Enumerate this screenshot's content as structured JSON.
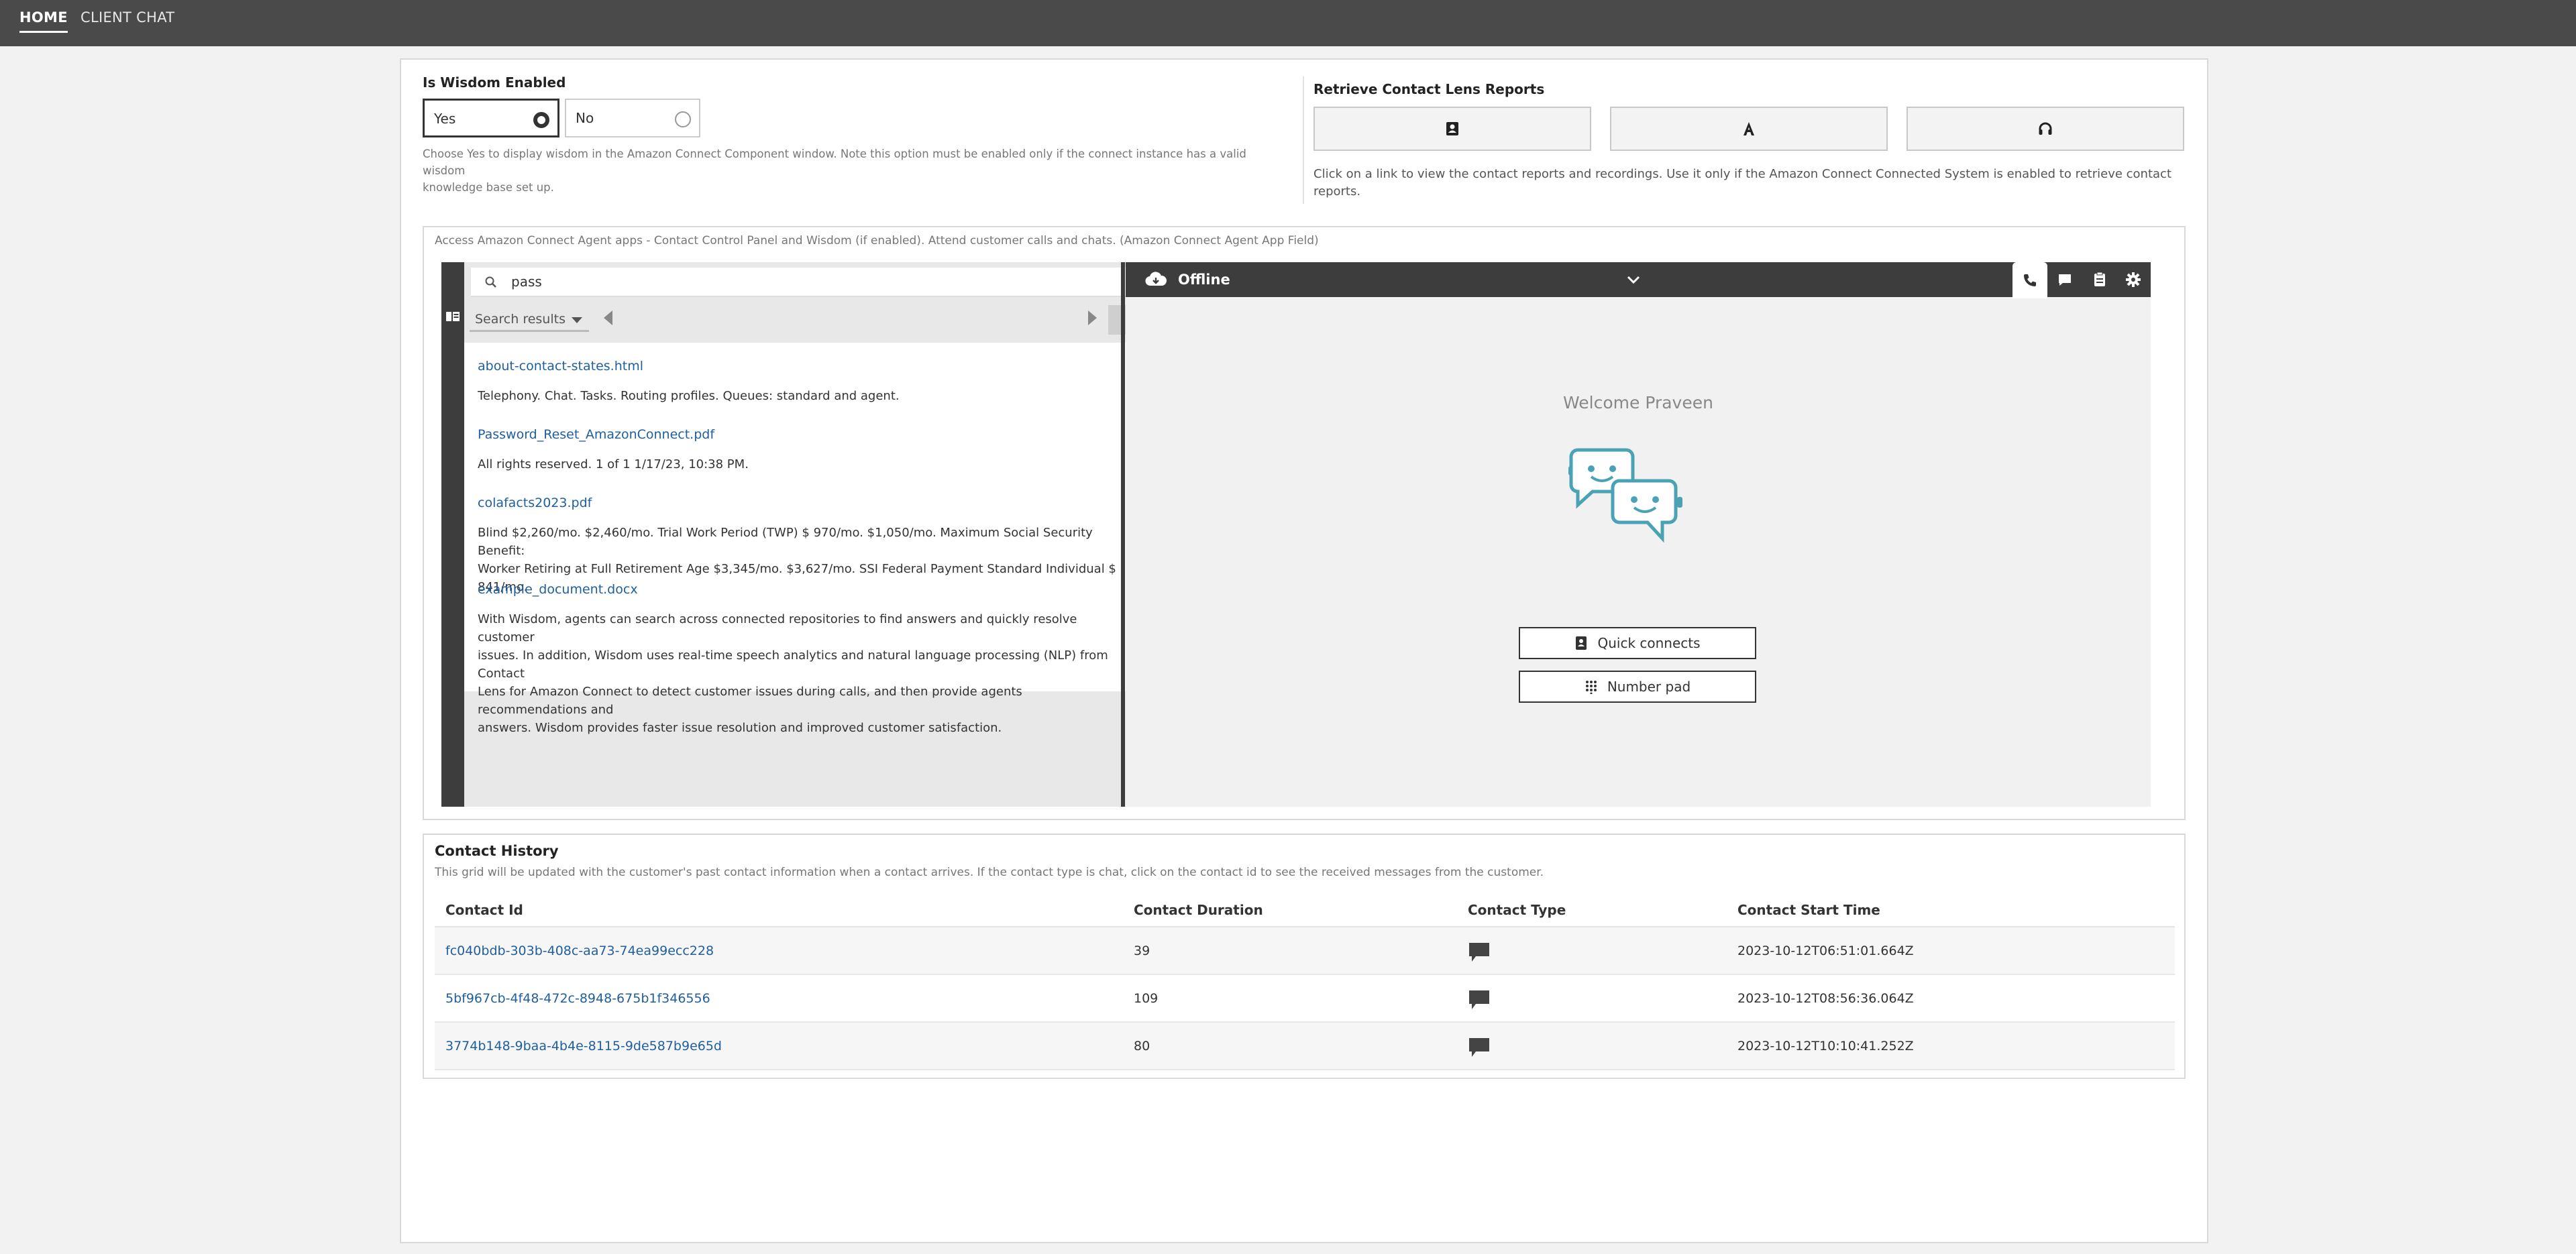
{
  "nav": {
    "tabs": [
      {
        "label": "HOME"
      },
      {
        "label": "CLIENT CHAT"
      }
    ]
  },
  "wisdom": {
    "title": "Is Wisdom Enabled",
    "options": [
      {
        "label": "Yes",
        "selected": true
      },
      {
        "label": "No",
        "selected": false
      }
    ],
    "help_line1": "Choose Yes to display wisdom in the Amazon Connect Component window. Note this option must be enabled only if the connect instance has a valid wisdom",
    "help_line2": "knowledge base set up."
  },
  "lens": {
    "title": "Retrieve Contact Lens Reports",
    "buttons": [
      {
        "icon": "contact-card-icon"
      },
      {
        "icon": "letter-a-icon"
      },
      {
        "icon": "headset-icon"
      }
    ],
    "help_line1": "Click on a link to view the contact reports and recordings. Use it only if the Amazon Connect Connected System is enabled to retrieve contact",
    "help_line2": "reports."
  },
  "agent_apps": {
    "caption": "Access Amazon Connect Agent apps - Contact Control Panel and Wisdom (if enabled). Attend customer calls and chats. (Amazon Connect Agent App Field)",
    "search_value": "pass",
    "dropdown_label": "Search results",
    "results": [
      {
        "title": "about-contact-states.html",
        "lines": [
          "Telephony. Chat. Tasks. Routing profiles. Queues: standard and agent."
        ]
      },
      {
        "title": "Password_Reset_AmazonConnect.pdf",
        "lines": [
          "All rights reserved. 1 of 1 1/17/23, 10:38 PM."
        ]
      },
      {
        "title": "colafacts2023.pdf",
        "lines": [
          "Blind $2,260/mo. $2,460/mo. Trial Work Period (TWP) $ 970/mo. $1,050/mo. Maximum Social Security Benefit:",
          "Worker Retiring at Full Retirement Age $3,345/mo. $3,627/mo. SSI Federal Payment Standard Individual $ 841/mo."
        ]
      },
      {
        "title": "example_document.docx",
        "lines": [
          "With Wisdom, agents can search across connected repositories to find answers and quickly resolve customer",
          "issues. In addition, Wisdom uses real-time speech analytics and natural language processing (NLP) from Contact",
          "Lens for Amazon Connect to detect customer issues during calls, and then provide agents recommendations and",
          "answers. Wisdom provides faster issue resolution and improved customer satisfaction."
        ]
      }
    ],
    "ccp": {
      "status": "Offline",
      "welcome": "Welcome Praveen",
      "quick_connects": "Quick connects",
      "number_pad": "Number pad",
      "colors": {
        "bot": "#4aa3b5",
        "header": "#3d3d3d"
      }
    }
  },
  "history": {
    "title": "Contact History",
    "subtitle": "This grid will be updated with the customer's past contact information when a contact arrives. If the contact type is chat, click on the contact id to see the received messages from the customer.",
    "columns": [
      "Contact Id",
      "Contact Duration",
      "Contact Type",
      "Contact Start Time"
    ],
    "rows": [
      {
        "id": "fc040bdb-303b-408c-aa73-74ea99ecc228",
        "duration": "39",
        "type": "chat-icon",
        "start": "2023-10-12T06:51:01.664Z"
      },
      {
        "id": "5bf967cb-4f48-472c-8948-675b1f346556",
        "duration": "109",
        "type": "chat-icon",
        "start": "2023-10-12T08:56:36.064Z"
      },
      {
        "id": "3774b148-9baa-4b4e-8115-9de587b9e65d",
        "duration": "80",
        "type": "chat-icon",
        "start": "2023-10-12T10:10:41.252Z"
      }
    ]
  }
}
